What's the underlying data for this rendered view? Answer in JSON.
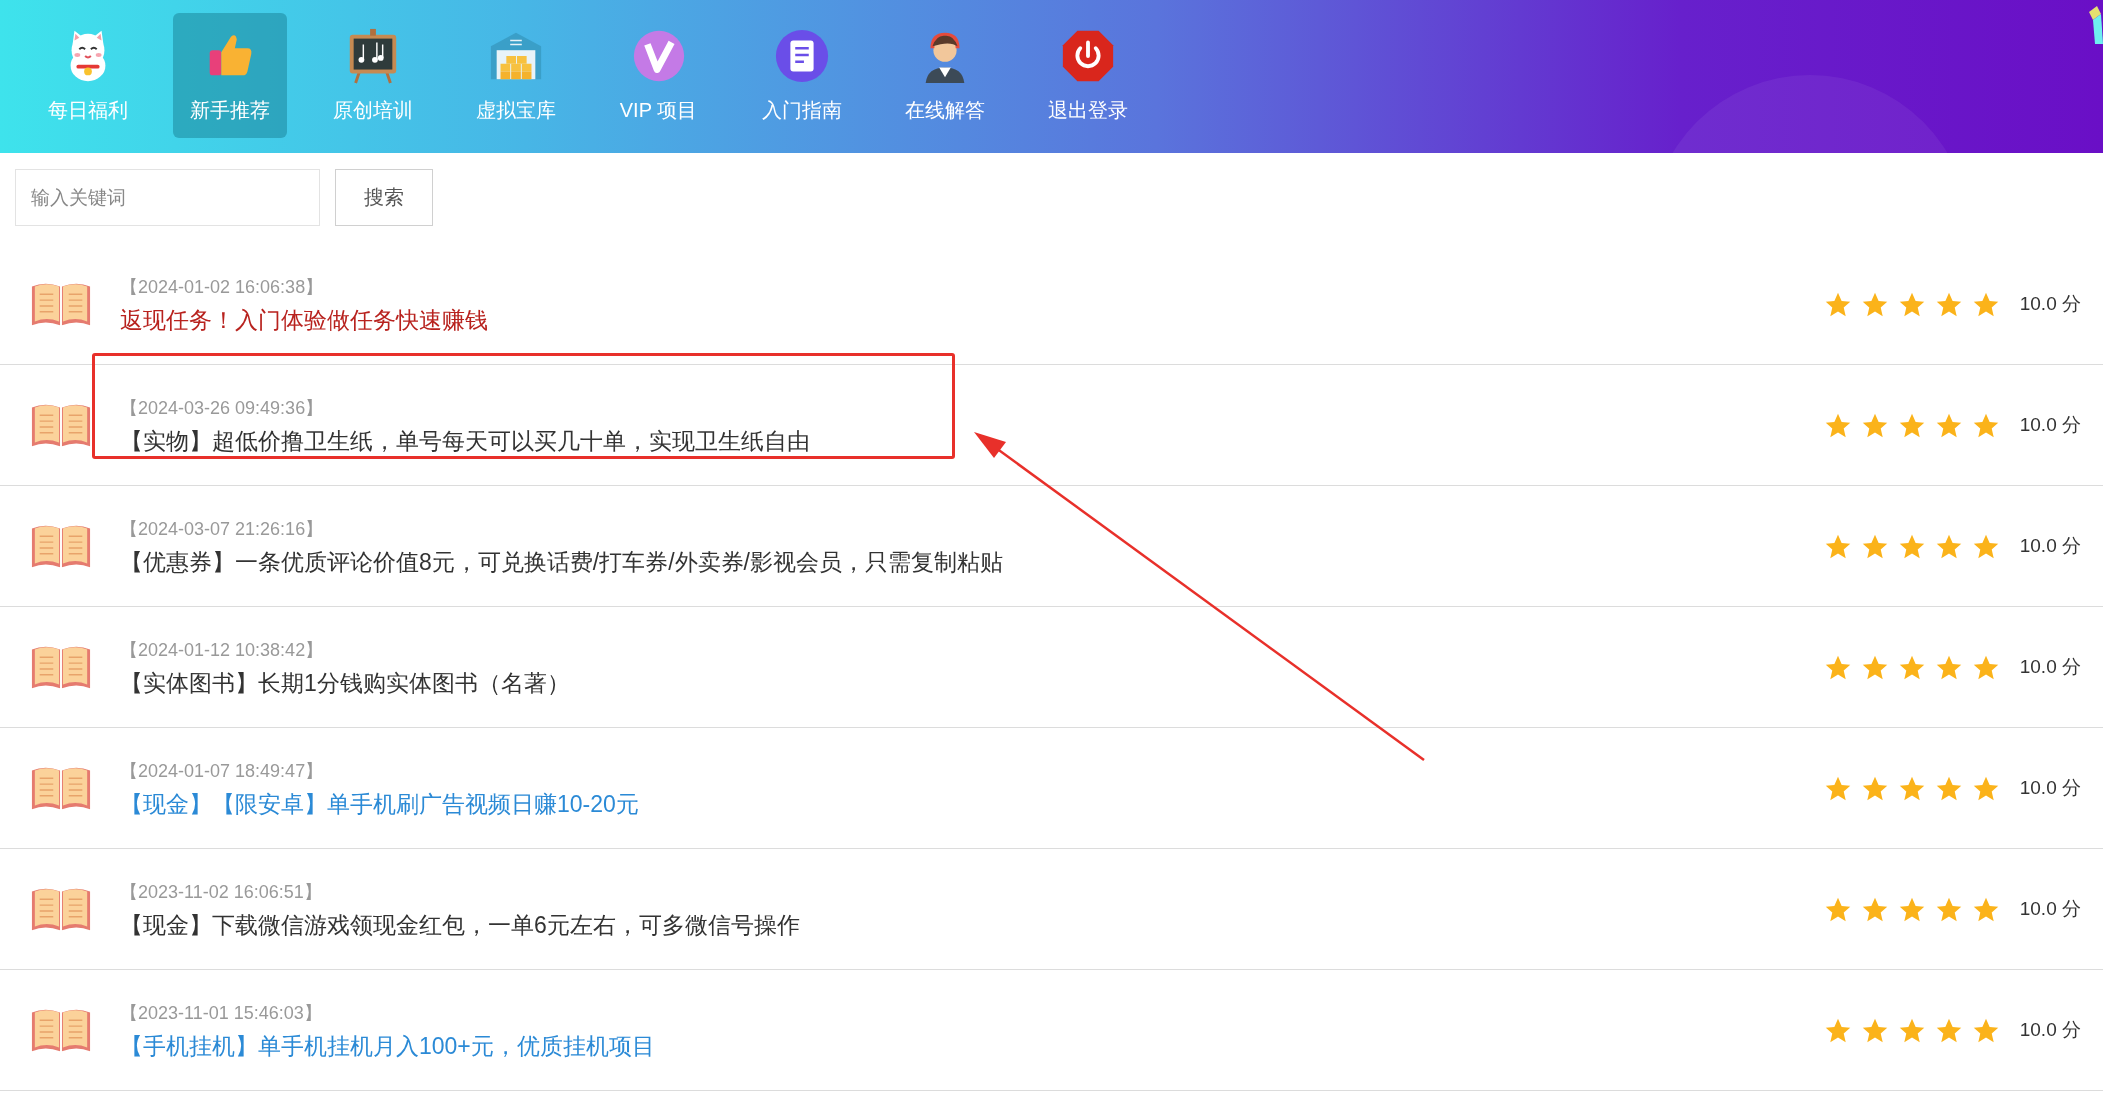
{
  "nav": [
    {
      "label": "每日福利",
      "selected": false
    },
    {
      "label": "新手推荐",
      "selected": true
    },
    {
      "label": "原创培训",
      "selected": false
    },
    {
      "label": "虚拟宝库",
      "selected": false
    },
    {
      "label": "VIP 项目",
      "selected": false
    },
    {
      "label": "入门指南",
      "selected": false
    },
    {
      "label": "在线解答",
      "selected": false
    },
    {
      "label": "退出登录",
      "selected": false
    }
  ],
  "search": {
    "placeholder": "输入关键词",
    "button": "搜索"
  },
  "rows": [
    {
      "date": "【2024-01-02 16:06:38】",
      "title": "返现任务！入门体验做任务快速赚钱",
      "color": "#b8221e",
      "stars": 5,
      "score": "10.0 分",
      "highlighted": false
    },
    {
      "date": "【2024-03-26 09:49:36】",
      "title": "【实物】超低价撸卫生纸，单号每天可以买几十单，实现卫生纸自由",
      "color": "#333333",
      "stars": 5,
      "score": "10.0 分",
      "highlighted": true
    },
    {
      "date": "【2024-03-07 21:26:16】",
      "title": "【优惠券】一条优质评论价值8元，可兑换话费/打车券/外卖券/影视会员，只需复制粘贴",
      "color": "#333333",
      "stars": 5,
      "score": "10.0 分",
      "highlighted": false
    },
    {
      "date": "【2024-01-12 10:38:42】",
      "title": "【实体图书】长期1分钱购实体图书（名著）",
      "color": "#333333",
      "stars": 5,
      "score": "10.0 分",
      "highlighted": false
    },
    {
      "date": "【2024-01-07 18:49:47】",
      "title": "【现金】【限安卓】单手机刷广告视频日赚10-20元",
      "color": "#2b8ad6",
      "stars": 5,
      "score": "10.0 分",
      "highlighted": false
    },
    {
      "date": "【2023-11-02 16:06:51】",
      "title": "【现金】下载微信游戏领现金红包，一单6元左右，可多微信号操作",
      "color": "#333333",
      "stars": 5,
      "score": "10.0 分",
      "highlighted": false
    },
    {
      "date": "【2023-11-01 15:46:03】",
      "title": "【手机挂机】单手机挂机月入100+元，优质挂机项目",
      "color": "#2b8ad6",
      "stars": 5,
      "score": "10.0 分",
      "highlighted": false
    }
  ]
}
